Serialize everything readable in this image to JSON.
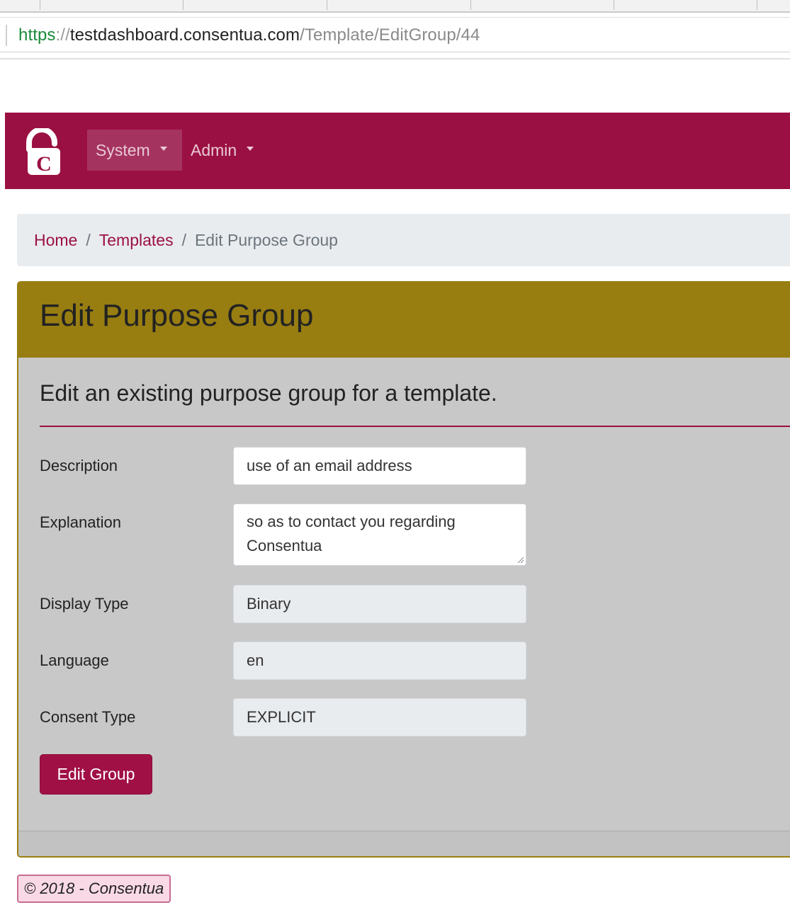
{
  "browser": {
    "url_scheme": "https",
    "url_sep": "://",
    "url_host": "testdashboard.consentua.com",
    "url_path": "/Template/EditGroup/44"
  },
  "navbar": {
    "logo_letter": "C",
    "items": [
      {
        "label": "System"
      },
      {
        "label": "Admin"
      }
    ]
  },
  "breadcrumb": {
    "home": "Home",
    "templates": "Templates",
    "separator": "/",
    "current": "Edit Purpose Group"
  },
  "card": {
    "title": "Edit Purpose Group",
    "subtitle": "Edit an existing purpose group for a template."
  },
  "form": {
    "description": {
      "label": "Description",
      "value": "use of an email address"
    },
    "explanation": {
      "label": "Explanation",
      "value": "so as to contact you regarding Consentua"
    },
    "display_type": {
      "label": "Display Type",
      "value": "Binary"
    },
    "language": {
      "label": "Language",
      "value": "en"
    },
    "consent_type": {
      "label": "Consent Type",
      "value": "EXPLICIT"
    },
    "submit_label": "Edit Group"
  },
  "footer": {
    "copyright": "© 2018 - Consentua"
  },
  "colors": {
    "brand": "#9b1042",
    "card_header": "#987d11",
    "card_body": "#c8c8c8",
    "breadcrumb_bg": "#e9ecef"
  }
}
